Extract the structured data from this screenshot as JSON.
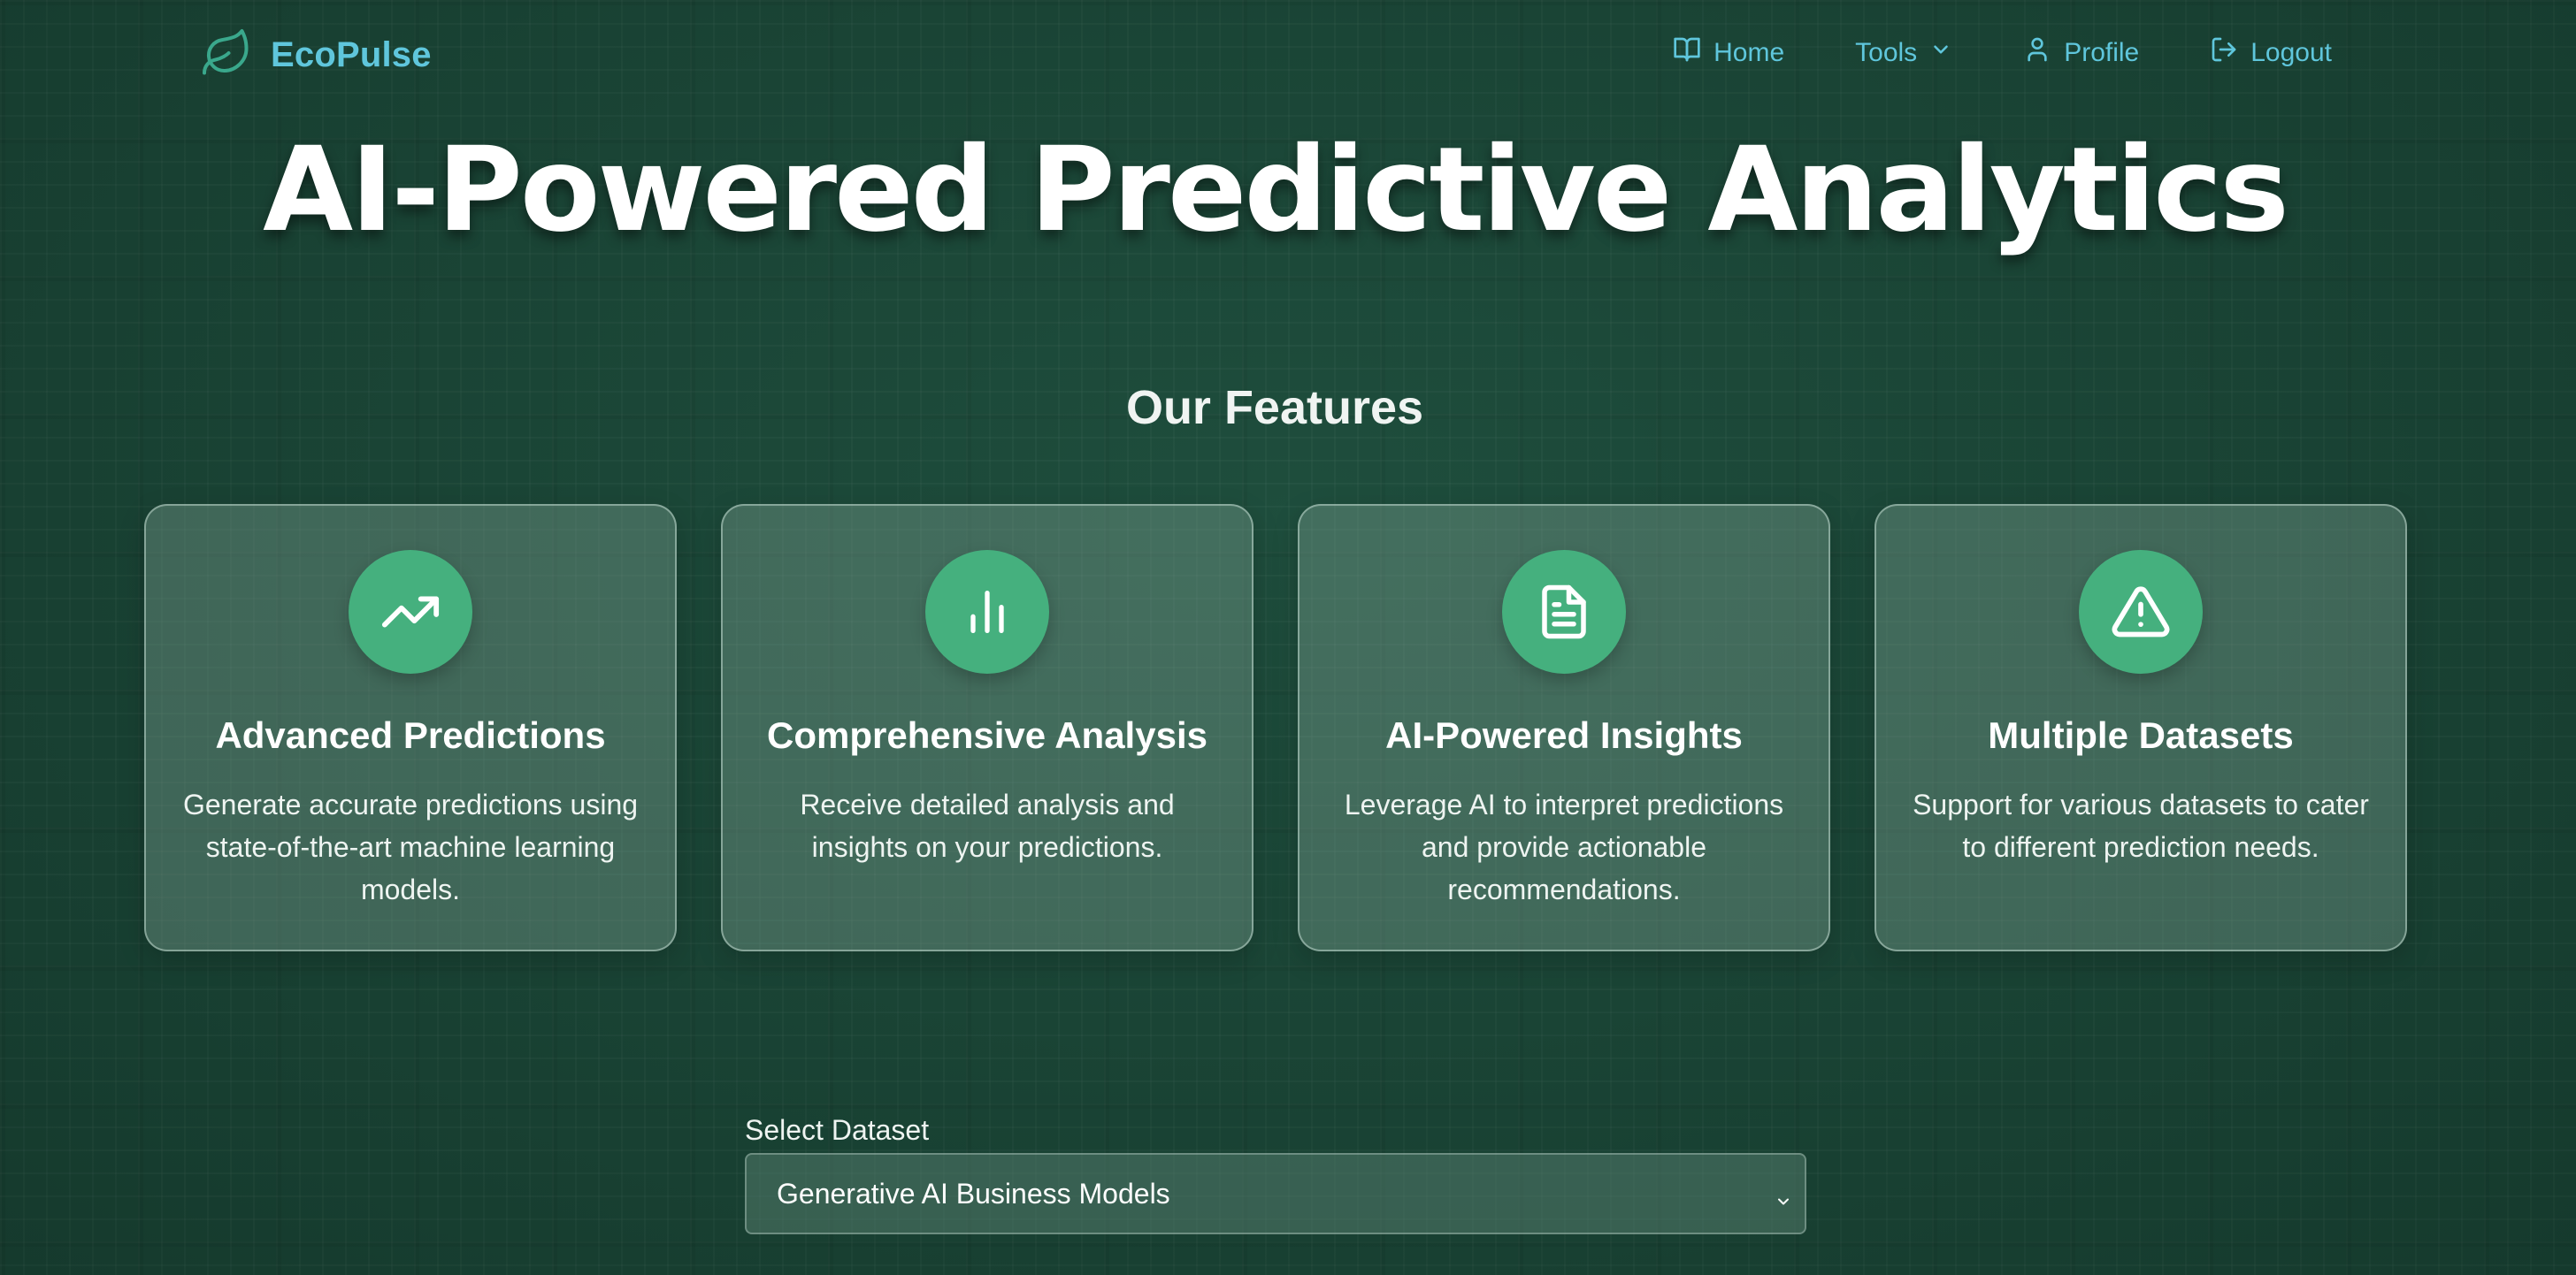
{
  "nav": {
    "brand": "EcoPulse",
    "links": [
      {
        "label": "Home",
        "icon": "book-open-icon"
      },
      {
        "label": "Tools",
        "icon": "chevron-down-icon"
      },
      {
        "label": "Profile",
        "icon": "user-icon"
      },
      {
        "label": "Logout",
        "icon": "log-out-icon"
      }
    ]
  },
  "hero": {
    "title": "AI-Powered Predictive Analytics"
  },
  "features": {
    "heading": "Our Features",
    "cards": [
      {
        "icon": "trending-up-icon",
        "title": "Advanced Predictions",
        "description": "Generate accurate predictions using state-of-the-art machine learning models."
      },
      {
        "icon": "bar-chart-icon",
        "title": "Comprehensive Analysis",
        "description": "Receive detailed analysis and insights on your predictions."
      },
      {
        "icon": "file-text-icon",
        "title": "AI-Powered Insights",
        "description": "Leverage AI to interpret predictions and provide actionable recommendations."
      },
      {
        "icon": "alert-triangle-icon",
        "title": "Multiple Datasets",
        "description": "Support for various datasets to cater to different prediction needs."
      }
    ]
  },
  "dataset": {
    "label": "Select Dataset",
    "selected": "Generative AI Business Models"
  },
  "colors": {
    "background": "#1b4637",
    "accent": "#5fc6dc",
    "icon_bg": "#45b07e"
  }
}
